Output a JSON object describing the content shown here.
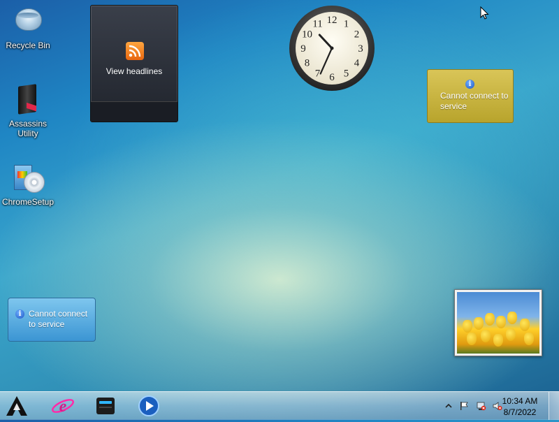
{
  "desktop_icons": [
    {
      "label": "Recycle Bin",
      "icon": "recycle-bin-icon"
    },
    {
      "label": "Assassins Utility",
      "icon": "assassins-utility-icon"
    },
    {
      "label": "ChromeSetup",
      "icon": "installer-icon"
    }
  ],
  "gadgets": {
    "feed": {
      "label": "View headlines",
      "icon": "rss-icon"
    },
    "clock": {
      "hour": 10,
      "minute": 34
    },
    "weather": {
      "message": "Cannot connect to service"
    },
    "currency": {
      "message": "Cannot connect to service"
    },
    "slideshow": {
      "subject": "yellow tulips"
    }
  },
  "taskbar": {
    "pinned": [
      "start-button",
      "internet-explorer-icon",
      "file-manager-icon",
      "media-player-icon"
    ],
    "tray": {
      "icons": [
        "show-hidden-icons-chevron",
        "action-center-flag-icon",
        "network-disconnected-icon",
        "volume-muted-icon"
      ],
      "time": "10:34 AM",
      "date": "8/7/2022"
    }
  },
  "colors": {
    "rss_orange": "#f07f1a",
    "weather_gold": "#c9b43c",
    "gadget_blue": "#5aaee0",
    "taskbar_glass": "#c8dced"
  }
}
